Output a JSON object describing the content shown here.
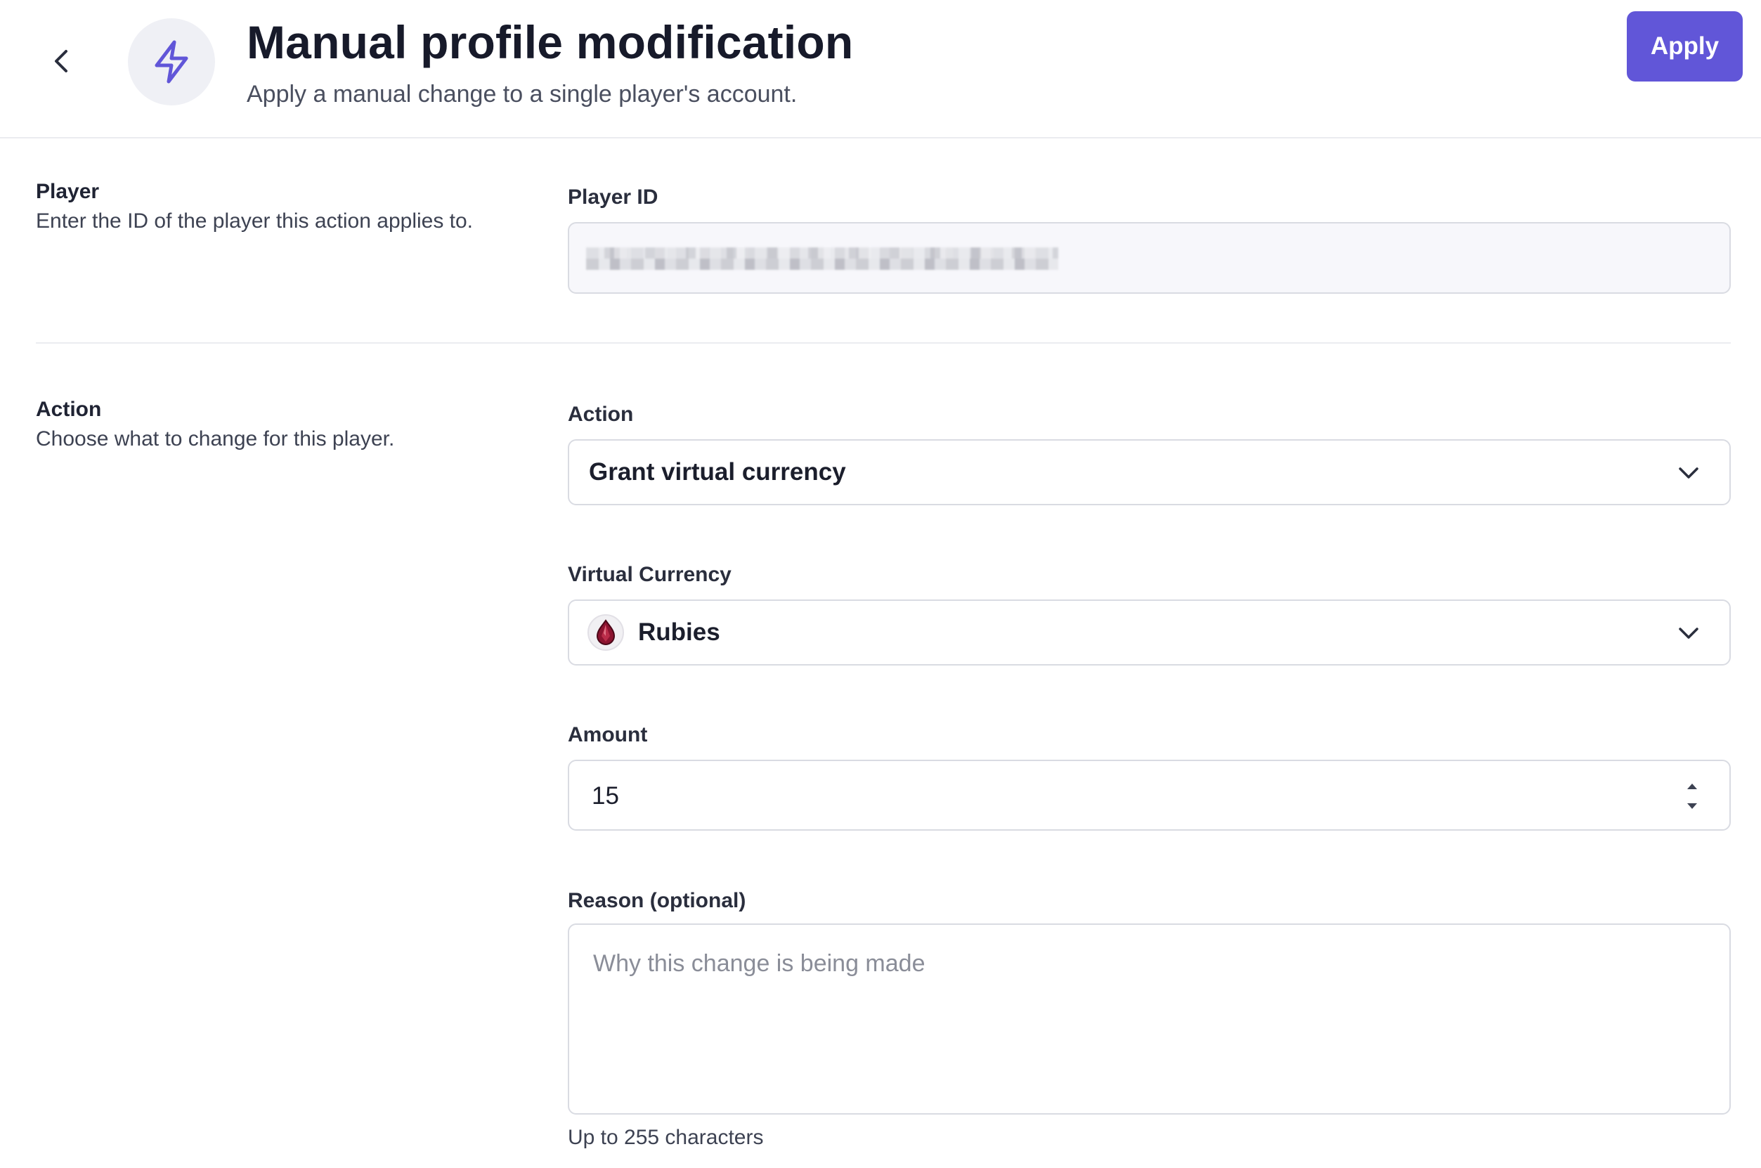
{
  "header": {
    "title": "Manual profile modification",
    "subtitle": "Apply a manual change to a single player's account.",
    "apply_label": "Apply",
    "accent_color": "#6156d8"
  },
  "player_section": {
    "title": "Player",
    "description": "Enter the ID of the player this action applies to.",
    "field_label": "Player ID"
  },
  "action_section": {
    "title": "Action",
    "description": "Choose what to change for this player.",
    "action_field": {
      "label": "Action",
      "selected": "Grant virtual currency"
    },
    "currency_field": {
      "label": "Virtual Currency",
      "selected": "Rubies",
      "icon": "ruby-gem-icon"
    },
    "amount_field": {
      "label": "Amount",
      "value": "15"
    },
    "reason_field": {
      "label": "Reason (optional)",
      "placeholder": "Why this change is being made",
      "helper": "Up to 255 characters"
    }
  }
}
